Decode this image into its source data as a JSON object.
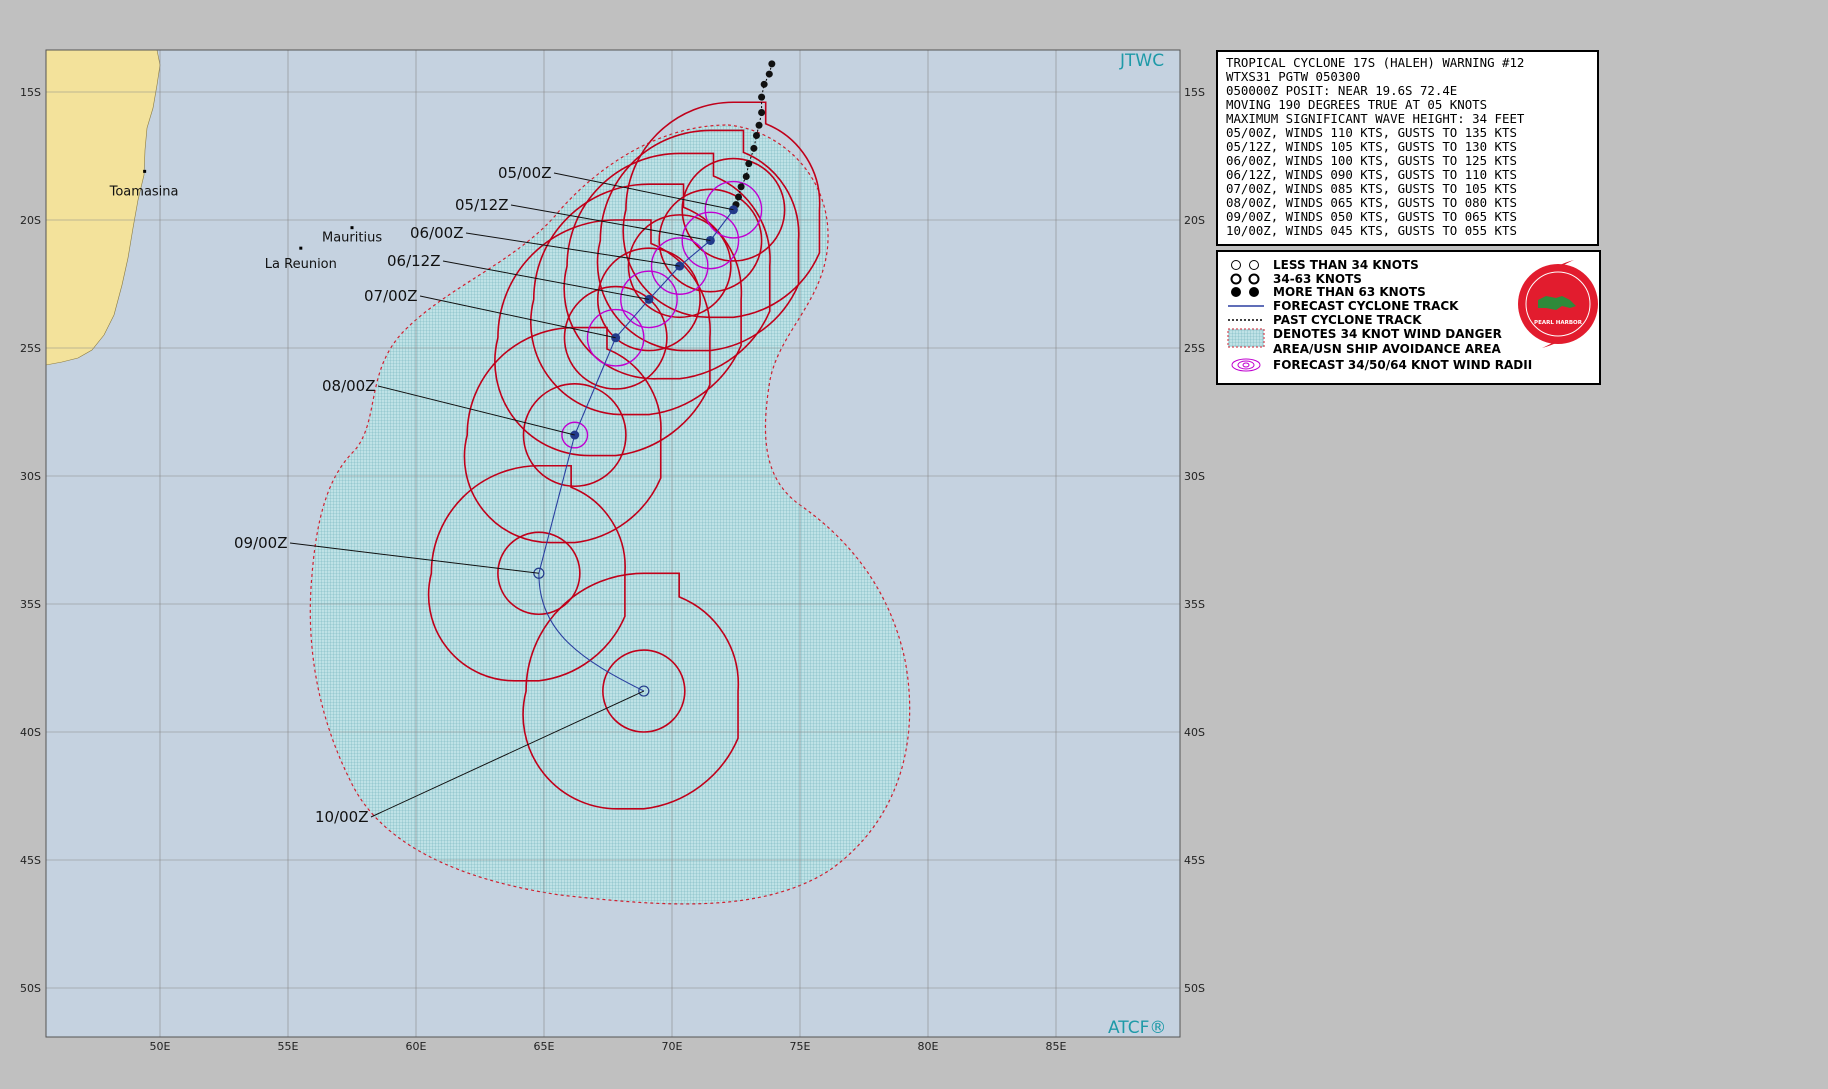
{
  "map": {
    "agency_label": "JTWC",
    "footer_label": "ATCF®",
    "lat_labels": [
      "15S",
      "20S",
      "25S",
      "30S",
      "35S",
      "40S",
      "45S",
      "50S"
    ],
    "lon_labels": [
      "50E",
      "55E",
      "60E",
      "65E",
      "70E",
      "75E",
      "80E",
      "85E"
    ],
    "places": [
      {
        "name": "Toamasina",
        "lon": 49.4,
        "lat": -18.1
      },
      {
        "name": "Mauritius",
        "lon": 57.5,
        "lat": -20.3
      },
      {
        "name": "La Reunion",
        "lon": 55.5,
        "lat": -21.1
      }
    ],
    "land_color": "#f3e29b",
    "ocean_color": "#c5d2e0",
    "danger_area_color": "#a6d0d6",
    "wind_radii_color": "#c0001a",
    "forecast_radii_color": "#c000d0",
    "track_color": "#2b3fa0"
  },
  "warning": {
    "lines": [
      "TROPICAL CYCLONE 17S (HALEH) WARNING #12",
      "WTXS31 PGTW 050300",
      "050000Z POSIT: NEAR 19.6S 72.4E",
      "MOVING 190 DEGREES TRUE AT 05 KNOTS",
      "MAXIMUM SIGNIFICANT WAVE HEIGHT: 34 FEET",
      "05/00Z, WINDS 110 KTS, GUSTS TO 135 KTS",
      "05/12Z, WINDS 105 KTS, GUSTS TO 130 KTS",
      "06/00Z, WINDS 100 KTS, GUSTS TO 125 KTS",
      "06/12Z, WINDS 090 KTS, GUSTS TO 110 KTS",
      "07/00Z, WINDS 085 KTS, GUSTS TO 105 KTS",
      "08/00Z, WINDS 065 KTS, GUSTS TO 080 KTS",
      "09/00Z, WINDS 050 KTS, GUSTS TO 065 KTS",
      "10/00Z, WINDS 045 KTS, GUSTS TO 055 KTS"
    ]
  },
  "legend": {
    "items": [
      {
        "icon": "cyclone-open-icon",
        "label": "LESS THAN 34 KNOTS"
      },
      {
        "icon": "cyclone-half-icon",
        "label": "34-63 KNOTS"
      },
      {
        "icon": "cyclone-filled-icon",
        "label": "MORE THAN 63 KNOTS"
      },
      {
        "icon": "solid-line-icon",
        "label": "FORECAST CYCLONE TRACK"
      },
      {
        "icon": "dotted-line-icon",
        "label": "PAST CYCLONE TRACK"
      },
      {
        "icon": "hatched-area-icon",
        "label": "DENOTES 34 KNOT WIND DANGER"
      },
      {
        "icon": "",
        "label": "AREA/USN SHIP AVOIDANCE AREA"
      },
      {
        "icon": "wind-radii-icon",
        "label": "FORECAST 34/50/64 KNOT WIND RADII"
      }
    ],
    "seal_text": "PEARL HARBOR"
  },
  "forecast": [
    {
      "label": "05/00Z",
      "lon": 72.4,
      "lat": -19.6,
      "winds_kt": 110
    },
    {
      "label": "05/12Z",
      "lon": 71.5,
      "lat": -20.8,
      "winds_kt": 105
    },
    {
      "label": "06/00Z",
      "lon": 70.3,
      "lat": -21.8,
      "winds_kt": 100
    },
    {
      "label": "06/12Z",
      "lon": 69.1,
      "lat": -23.1,
      "winds_kt": 90
    },
    {
      "label": "07/00Z",
      "lon": 67.8,
      "lat": -24.6,
      "winds_kt": 85
    },
    {
      "label": "08/00Z",
      "lon": 66.2,
      "lat": -28.4,
      "winds_kt": 65
    },
    {
      "label": "09/00Z",
      "lon": 64.8,
      "lat": -33.8,
      "winds_kt": 50
    },
    {
      "label": "10/00Z",
      "lon": 68.9,
      "lat": -38.4,
      "winds_kt": 45
    }
  ],
  "past_track": [
    {
      "lon": 73.9,
      "lat": -13.9
    },
    {
      "lon": 73.8,
      "lat": -14.3
    },
    {
      "lon": 73.6,
      "lat": -14.7
    },
    {
      "lon": 73.5,
      "lat": -15.2
    },
    {
      "lon": 73.5,
      "lat": -15.8
    },
    {
      "lon": 73.4,
      "lat": -16.3
    },
    {
      "lon": 73.3,
      "lat": -16.7
    },
    {
      "lon": 73.2,
      "lat": -17.2
    },
    {
      "lon": 73.0,
      "lat": -17.8
    },
    {
      "lon": 72.9,
      "lat": -18.3
    },
    {
      "lon": 72.7,
      "lat": -18.7
    },
    {
      "lon": 72.6,
      "lat": -19.1
    },
    {
      "lon": 72.5,
      "lat": -19.4
    }
  ]
}
